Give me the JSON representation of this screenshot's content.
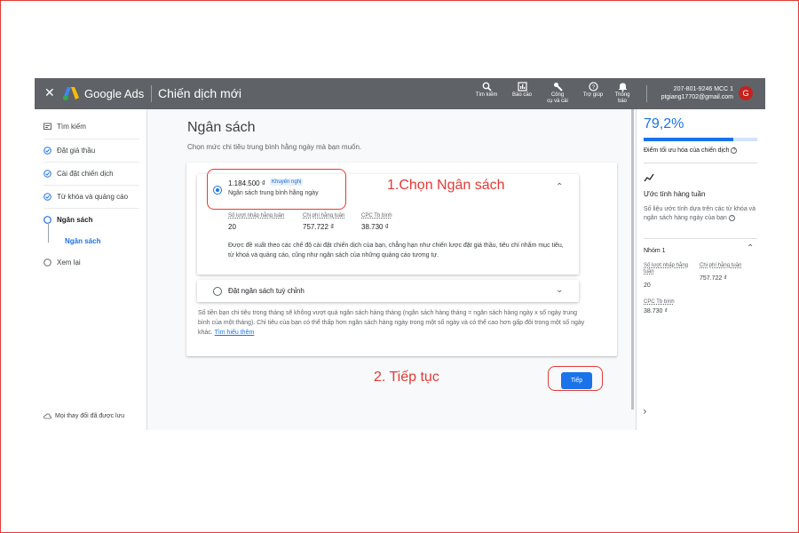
{
  "app": {
    "close_icon": "close-icon",
    "brand": "Google Ads",
    "window_title": "Chiến dịch mới"
  },
  "toolbar": [
    {
      "label_line1": "Tìm kiếm",
      "label_line2": "",
      "icon": "search-icon"
    },
    {
      "label_line1": "Báo cáo",
      "label_line2": "",
      "icon": "reports-icon"
    },
    {
      "label_line1": "Công",
      "label_line2": "cụ và cài",
      "icon": "wrench-icon"
    },
    {
      "label_line1": "Trợ giúp",
      "label_line2": "",
      "icon": "help-icon"
    },
    {
      "label_line1": "Thông",
      "label_line2": "báo",
      "icon": "bell-icon"
    }
  ],
  "account": {
    "id": "207-801-9246 MCC 1",
    "email": "ptgiang17702@gmail.com",
    "avatar_letter": "G"
  },
  "nav": {
    "items": [
      {
        "label": "Tìm kiếm",
        "state": "icon"
      },
      {
        "label": "Đặt giá thầu",
        "state": "done"
      },
      {
        "label": "Cài đặt chiến dịch",
        "state": "done"
      },
      {
        "label": "Từ khóa và quảng cáo",
        "state": "done"
      },
      {
        "label": "Ngân sách",
        "state": "current"
      },
      {
        "label": "Ngân sách",
        "state": "sub"
      },
      {
        "label": "Xem lại",
        "state": "todo"
      }
    ],
    "footer": "Mọi thay đổi đã được lưu"
  },
  "main": {
    "title": "Ngân sách",
    "subtitle": "Chọn mức chi tiêu trung bình hằng ngày mà bạn muốn.",
    "recommended": {
      "amount": "1.184.500 ₫",
      "chip": "Khuyến nghị",
      "desc": "Ngân sách trung bình hằng ngày",
      "metrics": [
        {
          "label": "Số lượt nhấp hằng tuần",
          "value": "20"
        },
        {
          "label": "Chi phí hằng tuần",
          "value": "757.722 ₫"
        },
        {
          "label": "CPC Tb bình",
          "value": "38.730 ₫"
        }
      ],
      "explanation": "Được đề xuất theo các chế độ cài đặt chiến dịch của bạn, chẳng hạn như chiến lược đặt giá thầu, tiêu chí nhắm mục tiêu, từ khoá và quảng cáo, cũng như ngân sách của những quảng cáo tương tự."
    },
    "custom": {
      "label": "Đặt ngân sách tuỳ chỉnh"
    },
    "footnote": "Số tiền bạn chi tiêu trong tháng sẽ không vượt quá ngân sách hàng tháng (ngân sách hàng tháng = ngân sách hàng ngày x số ngày trung bình của một tháng). Chỉ tiêu của bạn có thể thấp hơn ngân sách hàng ngày trong một số ngày và có thể cao hơn gấp đôi trong một số ngày khác.",
    "learn_more": "Tìm hiểu thêm",
    "next_button": "Tiếp"
  },
  "right_panel": {
    "score": "79,2%",
    "score_fraction": 0.792,
    "score_label": "Điểm tối ưu hóa của chiến dịch",
    "weekly_title": "Ước tính hàng tuần",
    "weekly_desc": "Số liệu ước tính dựa trên các từ khóa và ngân sách hàng ngày của bạn",
    "group": "Nhóm 1",
    "metrics": [
      {
        "label": "Số lượt nhấp hằng tuần",
        "value": "20"
      },
      {
        "label": "Chi phí hằng tuần",
        "value": "757.722 ₫"
      },
      {
        "label": "CPC Tb bình",
        "value": "38.730 ₫"
      }
    ]
  },
  "annotations": {
    "step1": "1.Chọn Ngân sách",
    "step2": "2. Tiếp tục",
    "color": "#e53935"
  },
  "colors": {
    "topbar": "#5f6368",
    "accent": "#1a73e8"
  }
}
